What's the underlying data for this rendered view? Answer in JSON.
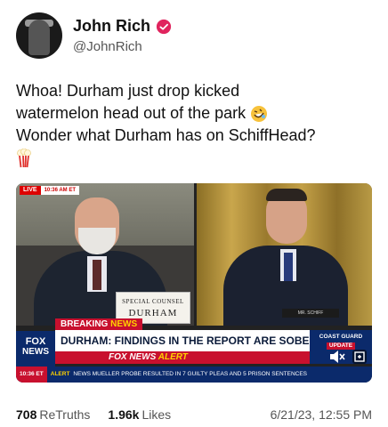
{
  "author": {
    "name": "John Rich",
    "handle": "@JohnRich",
    "verified": true,
    "icons": {
      "avatar": "profile-photo",
      "badge": "verified-badge-icon"
    }
  },
  "post": {
    "lines": [
      "Whoa! Durham just drop kicked",
      "watermelon head out of the park",
      "Wonder what Durham has on SchiffHead?"
    ],
    "emojis": [
      "rofl-emoji",
      "popcorn-emoji"
    ]
  },
  "media": {
    "live_label": "LIVE",
    "live_time": "10:36 AM ET",
    "nameplate_title": "SPECIAL COUNSEL",
    "nameplate_name": "DURHAM",
    "nameplate_right": "MR. SCHIFF",
    "breaking": "BREAKING",
    "breaking_news": "NEWS",
    "headline": "DURHAM: FINDINGS IN THE REPORT ARE SOBERING",
    "alert_prefix": "FOX NEWS",
    "alert_word": "ALERT",
    "fox_logo": "FOX",
    "fox_logo_news": "NEWS",
    "ticker_time": "10:36 ET",
    "ticker_alert": "ALERT",
    "ticker_text": "NEWS MUELLER PROBE RESULTED IN 7 GUILTY PLEAS AND 5 PRISON SENTENCES",
    "side_top": "COAST GUARD",
    "side_badge": "UPDATE"
  },
  "stats": {
    "retruths_count": "708",
    "retruths_label": "ReTruths",
    "likes_count": "1.96k",
    "likes_label": "Likes",
    "date": "6/21/23, 12:55 PM"
  },
  "colors": {
    "fox_red": "#c8102e",
    "fox_blue": "#0b2a6b",
    "verified": "#e0245e"
  }
}
